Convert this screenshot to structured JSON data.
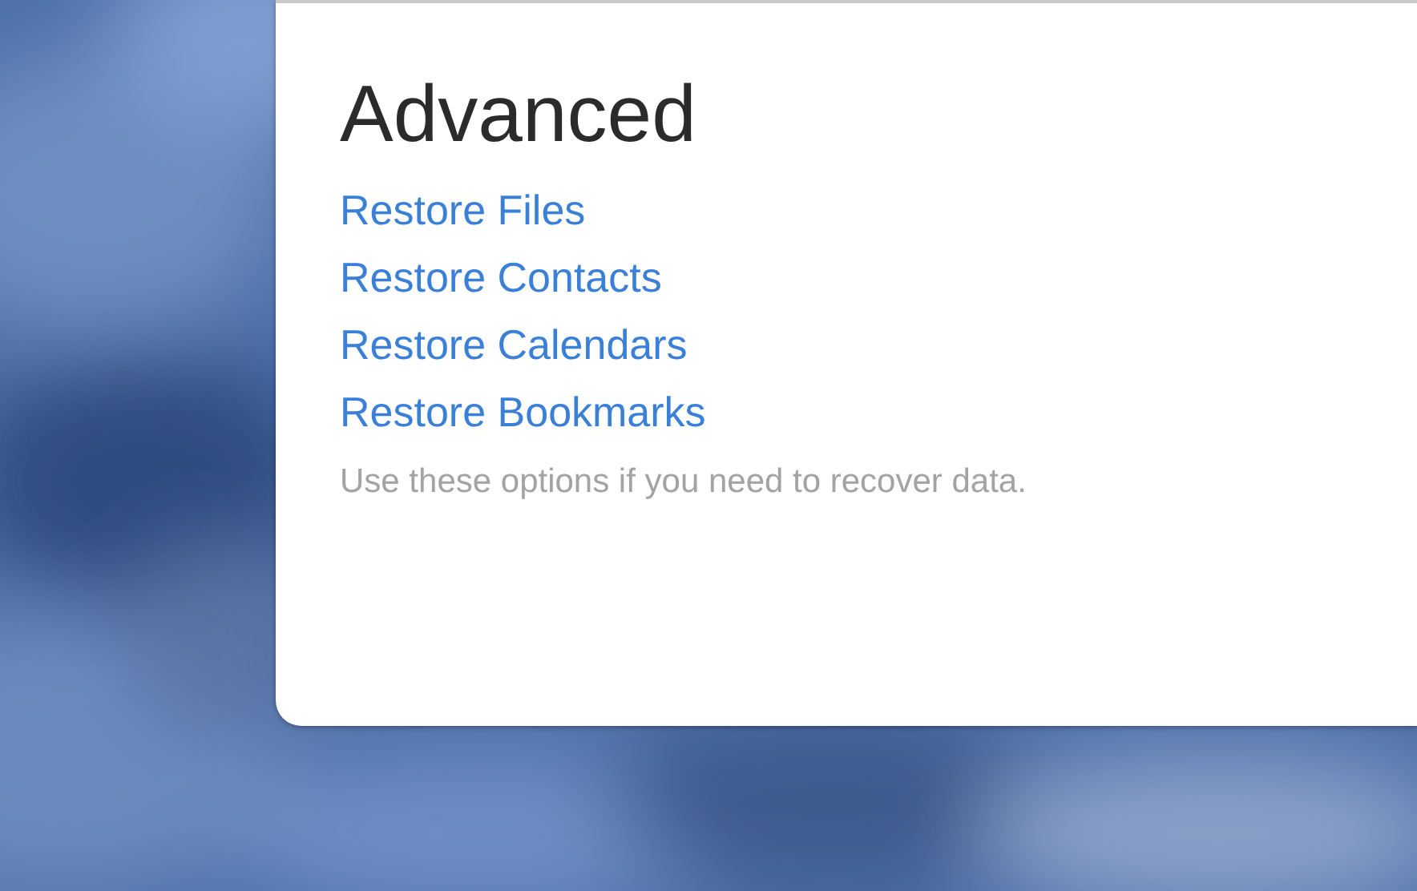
{
  "panel": {
    "title": "Advanced",
    "links": [
      {
        "label": "Restore Files"
      },
      {
        "label": "Restore Contacts"
      },
      {
        "label": "Restore Calendars"
      },
      {
        "label": "Restore Bookmarks"
      }
    ],
    "note": "Use these options if you need to recover data."
  }
}
